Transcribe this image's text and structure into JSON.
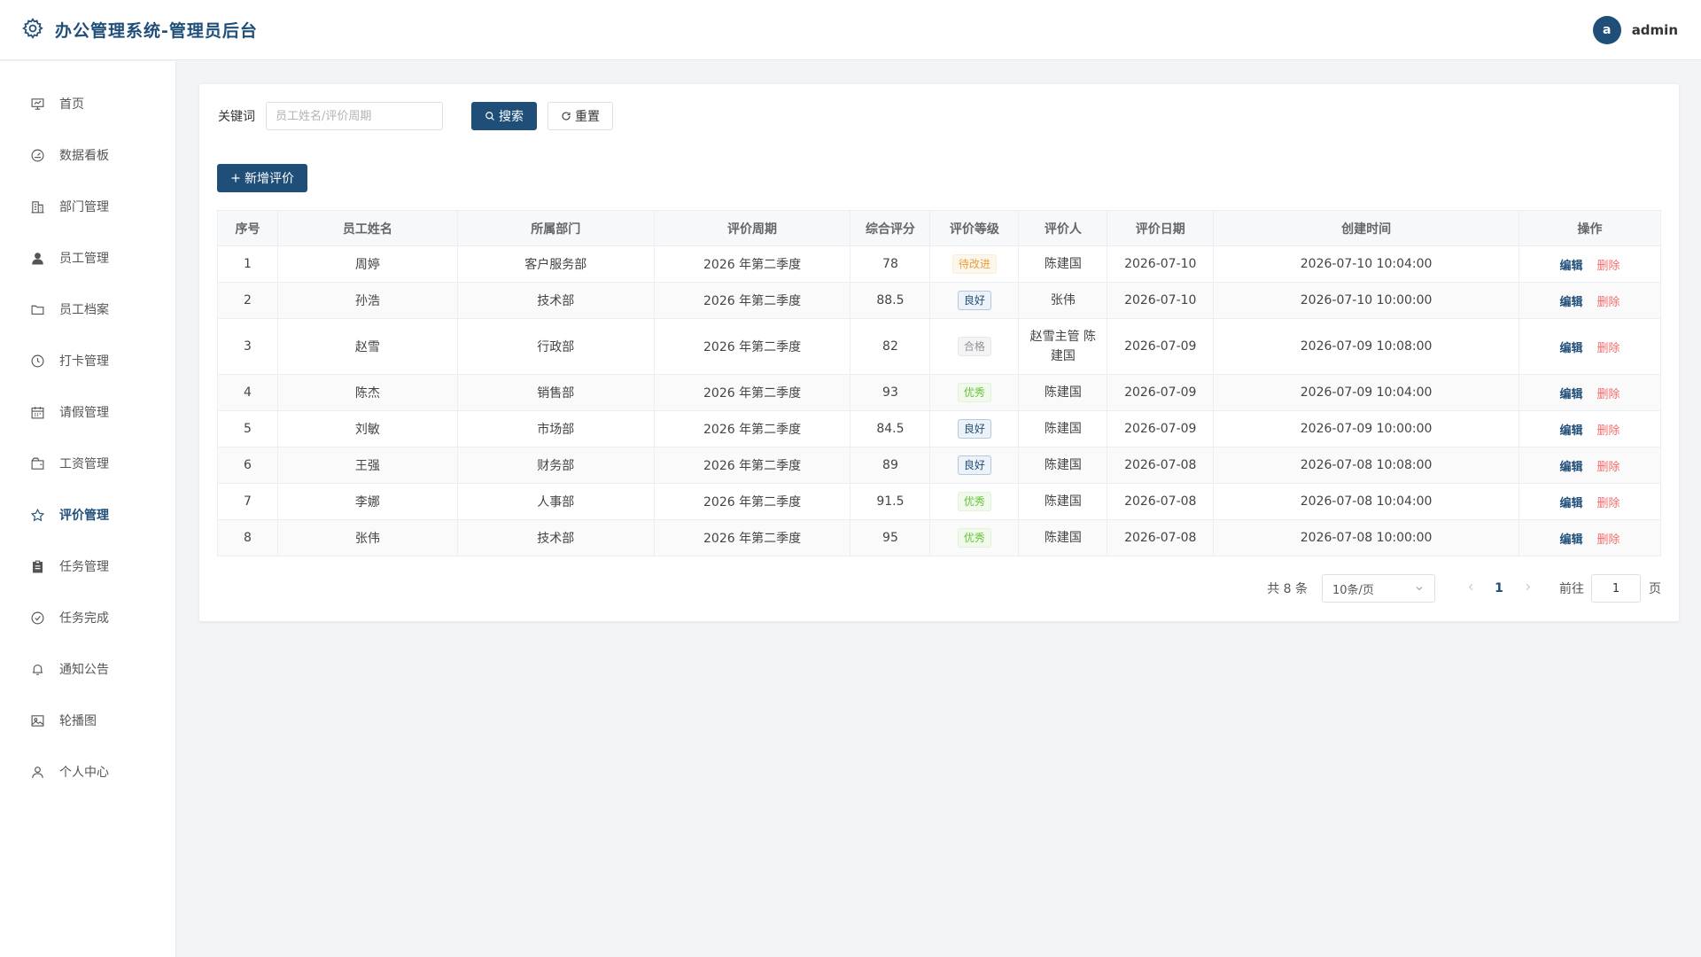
{
  "header": {
    "title": "办公管理系统-管理员后台",
    "avatar_letter": "a",
    "username": "admin"
  },
  "sidebar": {
    "items": [
      {
        "label": "首页",
        "icon": "home-icon"
      },
      {
        "label": "数据看板",
        "icon": "dashboard-icon"
      },
      {
        "label": "部门管理",
        "icon": "building-icon"
      },
      {
        "label": "员工管理",
        "icon": "user-filled-icon"
      },
      {
        "label": "员工档案",
        "icon": "folder-icon"
      },
      {
        "label": "打卡管理",
        "icon": "clock-icon"
      },
      {
        "label": "请假管理",
        "icon": "calendar-icon"
      },
      {
        "label": "工资管理",
        "icon": "wallet-icon"
      },
      {
        "label": "评价管理",
        "icon": "star-icon",
        "active": true
      },
      {
        "label": "任务管理",
        "icon": "clipboard-icon"
      },
      {
        "label": "任务完成",
        "icon": "check-circle-icon"
      },
      {
        "label": "通知公告",
        "icon": "bell-icon"
      },
      {
        "label": "轮播图",
        "icon": "picture-icon"
      },
      {
        "label": "个人中心",
        "icon": "user-icon"
      }
    ]
  },
  "search": {
    "label": "关键词",
    "placeholder": "员工姓名/评价周期",
    "search_label": "搜索",
    "reset_label": "重置"
  },
  "toolbar": {
    "add_label": "新增评价"
  },
  "table": {
    "headers": [
      "序号",
      "员工姓名",
      "所属部门",
      "评价周期",
      "综合评分",
      "评价等级",
      "评价人",
      "评价日期",
      "创建时间",
      "操作"
    ],
    "edit_label": "编辑",
    "delete_label": "删除",
    "rows": [
      {
        "no": "1",
        "name": "周婷",
        "dept": "客户服务部",
        "period": "2026 年第二季度",
        "score": "78",
        "level": "待改进",
        "level_type": "improve",
        "evaluator": "陈建国",
        "date": "2026-07-10",
        "created": "2026-07-10 10:04:00"
      },
      {
        "no": "2",
        "name": "孙浩",
        "dept": "技术部",
        "period": "2026 年第二季度",
        "score": "88.5",
        "level": "良好",
        "level_type": "good",
        "evaluator": "张伟",
        "date": "2026-07-10",
        "created": "2026-07-10 10:00:00"
      },
      {
        "no": "3",
        "name": "赵雪",
        "dept": "行政部",
        "period": "2026 年第二季度",
        "score": "82",
        "level": "合格",
        "level_type": "pass",
        "evaluator": "赵雪主管 陈建国",
        "date": "2026-07-09",
        "created": "2026-07-09 10:08:00"
      },
      {
        "no": "4",
        "name": "陈杰",
        "dept": "销售部",
        "period": "2026 年第二季度",
        "score": "93",
        "level": "优秀",
        "level_type": "excellent",
        "evaluator": "陈建国",
        "date": "2026-07-09",
        "created": "2026-07-09 10:04:00"
      },
      {
        "no": "5",
        "name": "刘敏",
        "dept": "市场部",
        "period": "2026 年第二季度",
        "score": "84.5",
        "level": "良好",
        "level_type": "good",
        "evaluator": "陈建国",
        "date": "2026-07-09",
        "created": "2026-07-09 10:00:00"
      },
      {
        "no": "6",
        "name": "王强",
        "dept": "财务部",
        "period": "2026 年第二季度",
        "score": "89",
        "level": "良好",
        "level_type": "good",
        "evaluator": "陈建国",
        "date": "2026-07-08",
        "created": "2026-07-08 10:08:00"
      },
      {
        "no": "7",
        "name": "李娜",
        "dept": "人事部",
        "period": "2026 年第二季度",
        "score": "91.5",
        "level": "优秀",
        "level_type": "excellent",
        "evaluator": "陈建国",
        "date": "2026-07-08",
        "created": "2026-07-08 10:04:00"
      },
      {
        "no": "8",
        "name": "张伟",
        "dept": "技术部",
        "period": "2026 年第二季度",
        "score": "95",
        "level": "优秀",
        "level_type": "excellent",
        "evaluator": "陈建国",
        "date": "2026-07-08",
        "created": "2026-07-08 10:00:00"
      }
    ]
  },
  "pagination": {
    "total": "共 8 条",
    "page_size": "10条/页",
    "current_page": "1",
    "goto_label": "前往",
    "goto_value": "1",
    "page_unit": "页"
  },
  "colors": {
    "primary": "#1f4e79",
    "danger": "#f56c6c",
    "warning": "#e6a23c",
    "success": "#67c23a",
    "info": "#909399"
  }
}
